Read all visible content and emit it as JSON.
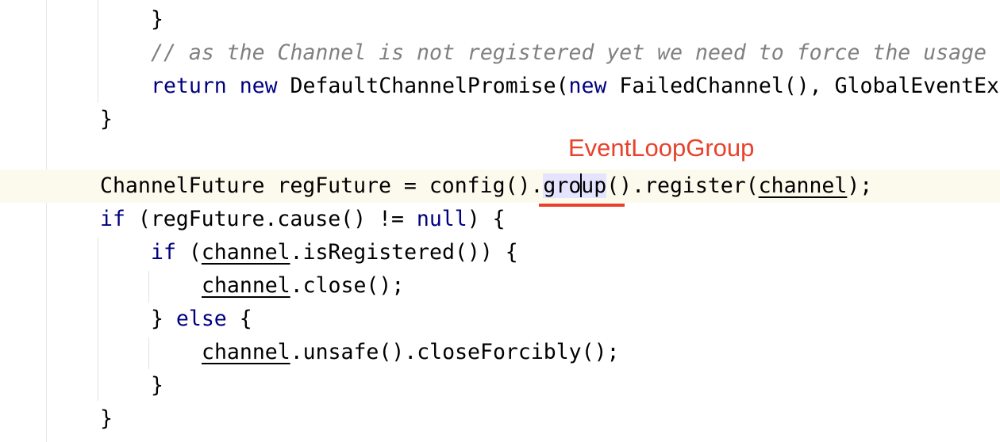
{
  "editor": {
    "lines": [
      {
        "text_a": "}"
      },
      {
        "comment": "// as the Channel is not registered yet we need to force the usage"
      },
      {
        "kw_return": "return",
        "kw_new": "new",
        "text_a": " DefaultChannelPromise(",
        "kw_new2": "new",
        "text_b": " FailedChannel(), GlobalEventEx"
      },
      {
        "text_a": "}"
      },
      {
        "text_a": "ChannelFuture regFuture = config().",
        "hl_a": "gro",
        "hl_b": "up",
        "text_b": "().register(",
        "ul": "channel",
        "text_c": ");"
      },
      {
        "kw_if": "if",
        "text_a": " (regFuture.cause() != ",
        "kw_null": "null",
        "text_b": ") {"
      },
      {
        "kw_if": "if",
        "text_a": " (",
        "ul": "channel",
        "text_b": ".isRegistered()) {"
      },
      {
        "ul": "channel",
        "text_a": ".close();"
      },
      {
        "text_a": "} ",
        "kw_else": "else",
        "text_b": " {"
      },
      {
        "ul": "channel",
        "text_a": ".unsafe().closeForcibly();"
      },
      {
        "text_a": "}"
      },
      {
        "text_a": "}"
      }
    ]
  },
  "annotation": {
    "label": "EventLoopGroup",
    "color": "#e8412c"
  },
  "colors": {
    "keyword": "#000080",
    "comment": "#808080",
    "current_line": "#fcfaed",
    "identifier_highlight": "#e4e4ff"
  }
}
